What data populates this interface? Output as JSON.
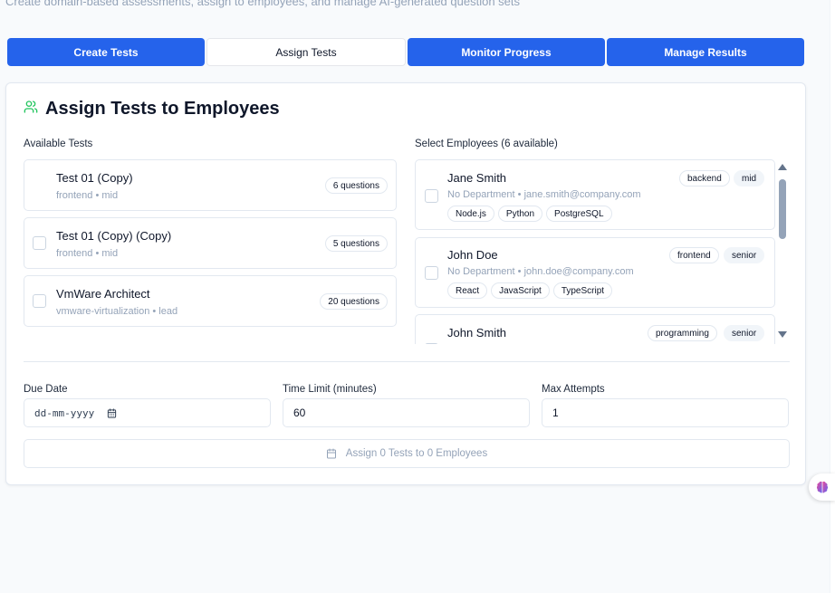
{
  "header": {
    "subtitle": "Create domain-based assessments, assign to employees, and manage AI-generated question sets"
  },
  "tabs": [
    {
      "label": "Create Tests",
      "active": false
    },
    {
      "label": "Assign Tests",
      "active": true
    },
    {
      "label": "Monitor Progress",
      "active": false
    },
    {
      "label": "Manage Results",
      "active": false
    }
  ],
  "card": {
    "title": "Assign Tests to Employees",
    "title_icon": "users-icon",
    "available_label": "Available Tests",
    "employees_label": "Select Employees (6 available)"
  },
  "tests": [
    {
      "name": "Test 01 (Copy)",
      "domain": "frontend",
      "level": "mid",
      "questions": "6 questions"
    },
    {
      "name": "Test 01 (Copy) (Copy)",
      "domain": "frontend",
      "level": "mid",
      "questions": "5 questions"
    },
    {
      "name": "VmWare Architect",
      "domain": "vmware-virtualization",
      "level": "lead",
      "questions": "20 questions"
    }
  ],
  "employees": [
    {
      "name": "Jane Smith",
      "department": "No Department",
      "email": "jane.smith@company.com",
      "domain": "backend",
      "level": "mid",
      "skills": [
        "Node.js",
        "Python",
        "PostgreSQL"
      ]
    },
    {
      "name": "John Doe",
      "department": "No Department",
      "email": "john.doe@company.com",
      "domain": "frontend",
      "level": "senior",
      "skills": [
        "React",
        "JavaScript",
        "TypeScript"
      ]
    },
    {
      "name": "John Smith",
      "department": "",
      "email": "",
      "domain": "programming",
      "level": "senior",
      "skills": []
    }
  ],
  "separator": "•",
  "form": {
    "due_date_label": "Due Date",
    "due_date_placeholder": "dd-mm-yyyy",
    "time_limit_label": "Time Limit (minutes)",
    "time_limit_value": "60",
    "max_attempts_label": "Max Attempts",
    "max_attempts_value": "1"
  },
  "assign_button": {
    "label": "Assign 0 Tests to 0 Employees"
  },
  "colors": {
    "primary": "#2563eb",
    "accent_green": "#22c55e"
  }
}
